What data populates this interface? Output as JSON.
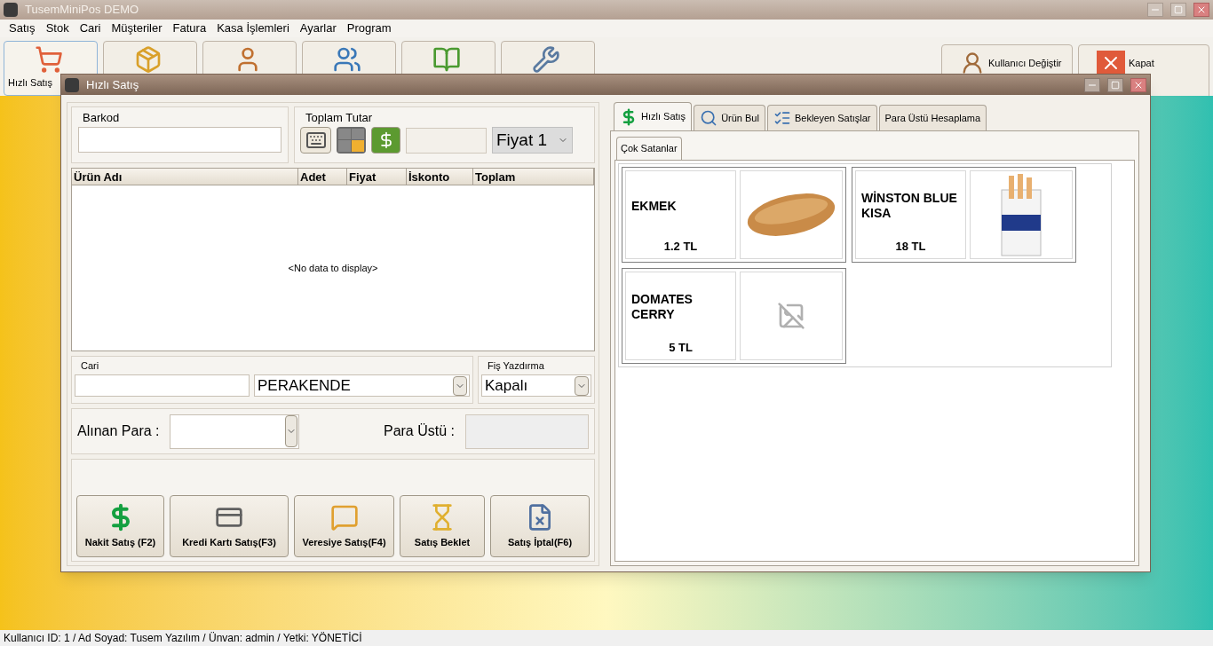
{
  "window": {
    "title": "TusemMiniPos DEMO"
  },
  "menu": [
    "Satış",
    "Stok",
    "Cari",
    "Müşteriler",
    "Fatura",
    "Kasa İşlemleri",
    "Ayarlar",
    "Program"
  ],
  "toolbar": [
    {
      "kind": "cart",
      "label": "Hızlı Satış",
      "selected": true
    },
    {
      "kind": "boxes",
      "selected": false
    },
    {
      "kind": "person",
      "selected": false
    },
    {
      "kind": "people",
      "selected": false
    },
    {
      "kind": "ledger",
      "selected": false
    },
    {
      "kind": "wrench",
      "selected": false
    }
  ],
  "toolbar_right": [
    {
      "kind": "user",
      "label": "Kullanıcı Değiştir"
    },
    {
      "kind": "close",
      "label": "Kapat"
    }
  ],
  "child_window": {
    "title": "Hızlı Satış",
    "barcode": {
      "label": "Barkod"
    },
    "total": {
      "label": "Toplam Tutar",
      "price_list": "Fiyat 1"
    },
    "grid": {
      "columns": [
        "Ürün Adı",
        "Adet",
        "Fiyat",
        "İskonto",
        "Toplam"
      ],
      "empty_text": "<No data to display>"
    },
    "customer": {
      "label": "Cari",
      "value": "PERAKENDE"
    },
    "receipt": {
      "label": "Fiş Yazdırma",
      "value": "Kapalı"
    },
    "received": {
      "label": "Alınan Para :"
    },
    "change": {
      "label": "Para Üstü :"
    },
    "actions": [
      {
        "kind": "cash",
        "label": "Nakit Satış (F2)"
      },
      {
        "kind": "card",
        "label": "Kredi Kartı Satış(F3)"
      },
      {
        "kind": "credit",
        "label": "Veresiye Satış(F4)"
      },
      {
        "kind": "hold",
        "label": "Satış Beklet"
      },
      {
        "kind": "cancel",
        "label": "Satış İptal(F6)"
      }
    ],
    "tabs": [
      {
        "kind": "dollar",
        "label": "Hızlı Satış",
        "selected": true
      },
      {
        "kind": "search",
        "label": "Ürün Bul",
        "selected": false
      },
      {
        "kind": "list",
        "label": "Bekleyen Satışlar",
        "selected": false
      },
      {
        "kind": "none",
        "label": "Para Üstü Hesaplama",
        "selected": false
      }
    ],
    "subtabs": [
      {
        "label": "Çok Satanlar",
        "selected": true
      }
    ],
    "products": [
      {
        "name": "EKMEK",
        "price": "1.2 TL",
        "kind": "bread"
      },
      {
        "name": "WİNSTON BLUE KISA",
        "price": "18 TL",
        "kind": "cigarettes"
      },
      {
        "name": "DOMATES CERRY",
        "price": "5 TL",
        "kind": "none"
      }
    ]
  },
  "status_bar": "Kullanıcı ID: 1 / Ad Soyad: Tusem Yazılım / Ünvan: admin / Yetki: YÖNETİCİ"
}
